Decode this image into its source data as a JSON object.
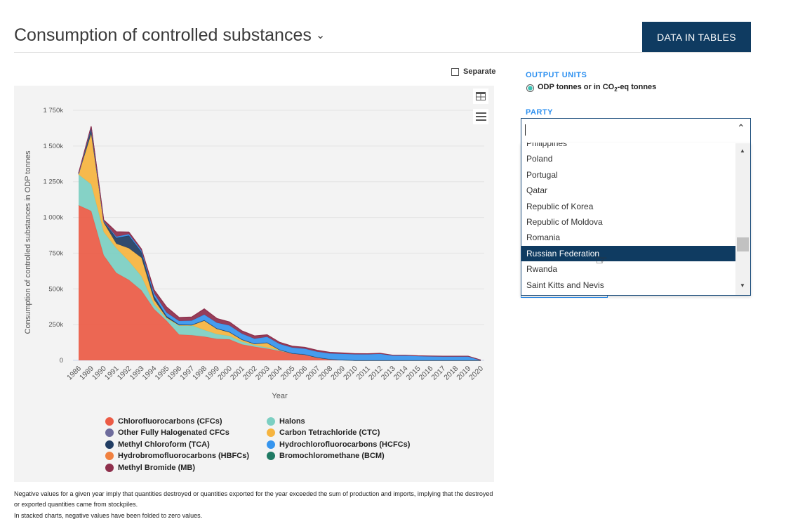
{
  "header": {
    "title": "Consumption of controlled substances",
    "title_icon": "chevron-down-icon",
    "data_tables_button": "DATA IN TABLES"
  },
  "chart_controls": {
    "separate_label": "Separate",
    "separate_checked": false,
    "table_icon": "table-icon",
    "menu_icon": "hamburger-menu-icon"
  },
  "sidebar": {
    "output_units_label": "OUTPUT UNITS",
    "output_units_option": "ODP tonnes or in CO",
    "output_units_sub": "2",
    "output_units_suffix": "-eq tonnes",
    "party_label": "PARTY",
    "party_input_value": "",
    "party_options": [
      "Philippines",
      "Poland",
      "Portugal",
      "Qatar",
      "Republic of Korea",
      "Republic of Moldova",
      "Romania",
      "Russian Federation",
      "Rwanda",
      "Saint Kitts and Nevis"
    ],
    "party_highlighted": "Russian Federation"
  },
  "notes": [
    "Negative values for a given year imply that quantities destroyed or quantities exported for the year exceeded the sum of production and imports, implying that the destroyed or exported quantities came from stockpiles.",
    "In stacked charts, negative values have been folded to zero values."
  ],
  "chart_data": {
    "type": "area",
    "stacked": true,
    "xlabel": "Year",
    "ylabel": "Consumption of controlled substances in ODP tonnes",
    "ylim": [
      0,
      1750000
    ],
    "yticks": [
      0,
      250000,
      500000,
      750000,
      1000000,
      1250000,
      1500000,
      1750000
    ],
    "ytick_labels": [
      "0",
      "250k",
      "500k",
      "750k",
      "1 000k",
      "1 250k",
      "1 500k",
      "1 750k"
    ],
    "grid": true,
    "legend_position": "bottom",
    "categories": [
      "1986",
      "1989",
      "1990",
      "1991",
      "1992",
      "1993",
      "1994",
      "1995",
      "1996",
      "1997",
      "1998",
      "1999",
      "2000",
      "2001",
      "2002",
      "2003",
      "2004",
      "2005",
      "2006",
      "2007",
      "2008",
      "2009",
      "2010",
      "2011",
      "2012",
      "2013",
      "2014",
      "2015",
      "2016",
      "2017",
      "2018",
      "2019",
      "2020"
    ],
    "series": [
      {
        "name": "Chlorofluorocarbons (CFCs)",
        "color": "#ec5b45",
        "values": [
          1085000,
          1045000,
          735000,
          612000,
          563000,
          490000,
          359000,
          277000,
          180000,
          176000,
          166000,
          150000,
          147000,
          111000,
          95000,
          82000,
          65000,
          49000,
          41000,
          20000,
          8000,
          3000,
          0,
          0,
          0,
          0,
          0,
          0,
          0,
          0,
          0,
          0,
          0
        ]
      },
      {
        "name": "Halons",
        "color": "#7ccfc2",
        "values": [
          215000,
          187000,
          163000,
          172000,
          131000,
          98000,
          33000,
          17000,
          65000,
          69000,
          46000,
          33000,
          24000,
          19000,
          11000,
          8000,
          5000,
          0,
          0,
          0,
          0,
          0,
          0,
          0,
          0,
          0,
          0,
          0,
          0,
          0,
          0,
          0,
          0
        ]
      },
      {
        "name": "Carbon Tetrachloride (CTC)",
        "color": "#f6b43f",
        "values": [
          0,
          351000,
          65000,
          32000,
          90000,
          130000,
          32000,
          5000,
          0,
          0,
          65000,
          37000,
          25000,
          14000,
          8000,
          32000,
          3000,
          0,
          0,
          0,
          0,
          0,
          0,
          0,
          0,
          0,
          0,
          0,
          0,
          0,
          0,
          0,
          0
        ]
      },
      {
        "name": "Methyl Chloroform (TCA)",
        "color": "#213d63",
        "values": [
          5000,
          50000,
          10000,
          41000,
          89000,
          41000,
          25000,
          10000,
          5000,
          3000,
          3000,
          3000,
          3000,
          2000,
          2000,
          2000,
          1000,
          0,
          0,
          0,
          0,
          0,
          0,
          0,
          0,
          0,
          0,
          0,
          0,
          0,
          0,
          0,
          0
        ]
      },
      {
        "name": "Hydrochlorofluorocarbons (HCFCs)",
        "color": "#3695ee",
        "values": [
          0,
          0,
          0,
          8000,
          10000,
          10000,
          20000,
          25000,
          25000,
          30000,
          40000,
          40000,
          45000,
          40000,
          35000,
          40000,
          40000,
          40000,
          40000,
          40000,
          40000,
          42000,
          42000,
          42000,
          45000,
          33000,
          33000,
          30000,
          28000,
          27000,
          27000,
          27000,
          2000
        ]
      },
      {
        "name": "Methyl Bromide (MB)",
        "color": "#8e2f4c",
        "values": [
          5000,
          5000,
          10000,
          35000,
          15000,
          10000,
          25000,
          40000,
          25000,
          25000,
          40000,
          30000,
          25000,
          20000,
          20000,
          15000,
          12000,
          10000,
          10000,
          10000,
          8000,
          7000,
          5000,
          4000,
          4000,
          3000,
          3000,
          2000,
          2000,
          2000,
          2000,
          2000,
          0
        ]
      },
      {
        "name": "Other Fully Halogenated CFCs",
        "color": "#6e6c9c",
        "values": [
          0,
          0,
          0,
          0,
          0,
          0,
          0,
          0,
          0,
          0,
          0,
          0,
          0,
          0,
          0,
          0,
          0,
          0,
          0,
          0,
          0,
          0,
          0,
          0,
          0,
          0,
          0,
          0,
          0,
          0,
          0,
          0,
          0
        ]
      },
      {
        "name": "Hydrobromofluorocarbons (HBFCs)",
        "color": "#f0803f",
        "values": [
          0,
          0,
          0,
          0,
          0,
          0,
          0,
          0,
          0,
          0,
          0,
          0,
          0,
          0,
          0,
          0,
          0,
          0,
          0,
          0,
          0,
          0,
          0,
          0,
          0,
          0,
          0,
          0,
          0,
          0,
          0,
          0,
          0
        ]
      },
      {
        "name": "Bromochloromethane (BCM)",
        "color": "#1f7a63",
        "values": [
          0,
          0,
          0,
          0,
          0,
          0,
          0,
          0,
          0,
          0,
          0,
          0,
          0,
          0,
          0,
          0,
          0,
          0,
          0,
          0,
          0,
          0,
          0,
          0,
          0,
          0,
          0,
          0,
          0,
          0,
          0,
          0,
          0
        ]
      }
    ],
    "legend_order": [
      "Chlorofluorocarbons (CFCs)",
      "Halons",
      "Other Fully Halogenated CFCs",
      "Carbon Tetrachloride (CTC)",
      "Methyl Chloroform (TCA)",
      "Hydrochlorofluorocarbons (HCFCs)",
      "Hydrobromofluorocarbons (HBFCs)",
      "Bromochloromethane (BCM)",
      "Methyl Bromide (MB)"
    ]
  }
}
